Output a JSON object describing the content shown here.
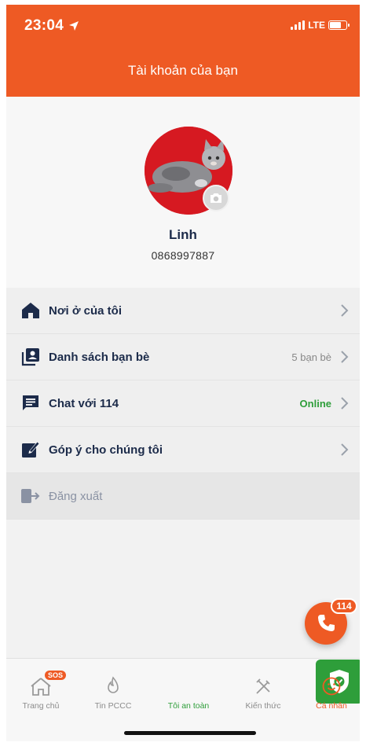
{
  "status_bar": {
    "time": "23:04",
    "network": "LTE"
  },
  "header": {
    "title": "Tài khoản của bạn"
  },
  "profile": {
    "name": "Linh",
    "phone": "0868997887"
  },
  "menu": [
    {
      "label": "Nơi ở của tôi",
      "icon": "home-icon",
      "extra": ""
    },
    {
      "label": "Danh sách bạn bè",
      "icon": "contacts-icon",
      "extra": "5 bạn bè"
    },
    {
      "label": "Chat với 114",
      "icon": "chat-icon",
      "extra": "Online"
    },
    {
      "label": "Góp ý cho chúng tôi",
      "icon": "edit-icon",
      "extra": ""
    },
    {
      "label": "Đăng xuất",
      "icon": "logout-icon",
      "extra": ""
    }
  ],
  "call_fab": {
    "badge": "114"
  },
  "tabs": [
    {
      "label": "Trang chủ",
      "icon": "home-sos-icon",
      "badge": "SOS"
    },
    {
      "label": "Tin PCCC",
      "icon": "fire-icon"
    },
    {
      "label": "Tôi an toàn",
      "icon": "shield-check-icon"
    },
    {
      "label": "Kiến thức",
      "icon": "tools-icon"
    },
    {
      "label": "Cá nhân",
      "icon": "smiley-icon"
    }
  ],
  "colors": {
    "accent": "#ee5a24",
    "safe_green": "#2e9e3a",
    "navy": "#1c2b4a",
    "avatar_bg": "#d61921"
  }
}
